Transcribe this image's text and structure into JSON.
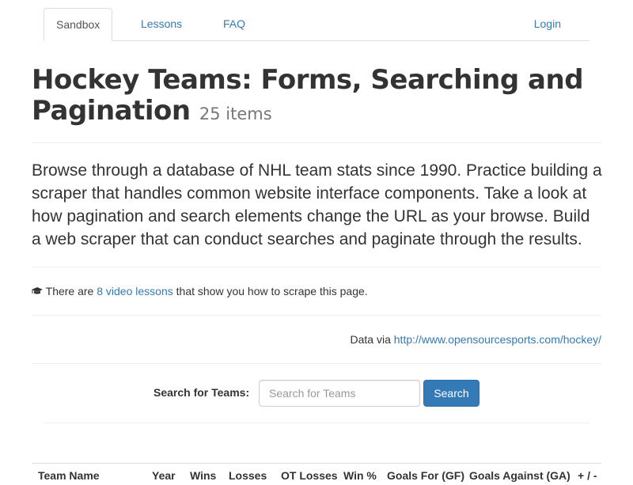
{
  "nav": {
    "tabs": [
      {
        "label": "Sandbox",
        "active": true
      },
      {
        "label": "Lessons",
        "active": false
      },
      {
        "label": "FAQ",
        "active": false
      }
    ],
    "login": "Login"
  },
  "header": {
    "title": "Hockey Teams: Forms, Searching and Pagination",
    "count": "25 items"
  },
  "intro": "Browse through a database of NHL team stats since 1990. Practice building a scraper that handles common website interface components. Take a look at how pagination and search elements change the URL as your browse. Build a web scraper that can conduct searches and paginate through the results.",
  "lessons": {
    "icon": "graduation-cap-icon",
    "prefix": "There are",
    "link": "8 video lessons",
    "suffix": "that show you how to scrape this page."
  },
  "credit": {
    "prefix": "Data via",
    "link": "http://www.opensourcesports.com/hockey/"
  },
  "search": {
    "label": "Search for Teams:",
    "placeholder": "Search for Teams",
    "value": "",
    "button": "Search"
  },
  "table": {
    "headers": [
      "Team Name",
      "Year",
      "Wins",
      "Losses",
      "OT Losses",
      "Win %",
      "Goals For (GF)",
      "Goals Against (GA)",
      "+ / -"
    ]
  },
  "colors": {
    "link": "#337ab7",
    "primary_button": "#337ab7"
  }
}
